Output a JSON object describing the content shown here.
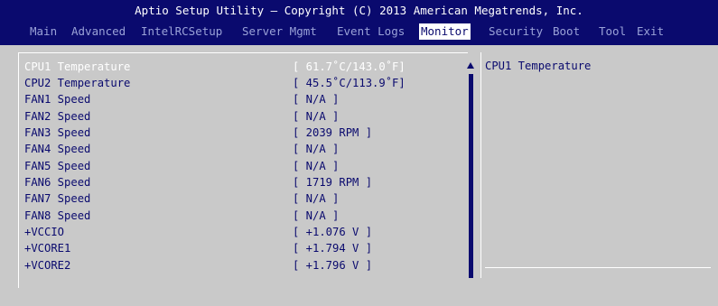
{
  "header": {
    "title": "Aptio Setup Utility – Copyright (C) 2013 American Megatrends, Inc."
  },
  "menu": {
    "tabs": [
      {
        "label": "Main",
        "active": false
      },
      {
        "label": "Advanced",
        "active": false
      },
      {
        "label": "IntelRCSetup",
        "active": false
      },
      {
        "label": "Server Mgmt",
        "active": false
      },
      {
        "label": "Event Logs",
        "active": false
      },
      {
        "label": "Monitor",
        "active": true
      },
      {
        "label": "Security",
        "active": false
      },
      {
        "label": "Boot",
        "active": false
      },
      {
        "label": "Tool",
        "active": false
      },
      {
        "label": "Exit",
        "active": false
      }
    ]
  },
  "monitor": {
    "rows": [
      {
        "label": "CPU1 Temperature",
        "value": "[ 61.7˚C/143.0˚F]",
        "selected": true
      },
      {
        "label": "CPU2 Temperature",
        "value": "[ 45.5˚C/113.9˚F]",
        "selected": false
      },
      {
        "label": "FAN1 Speed",
        "value": "[ N/A ]",
        "selected": false
      },
      {
        "label": "FAN2 Speed",
        "value": "[ N/A ]",
        "selected": false
      },
      {
        "label": "FAN3 Speed",
        "value": "[ 2039 RPM ]",
        "selected": false
      },
      {
        "label": "FAN4 Speed",
        "value": "[ N/A ]",
        "selected": false
      },
      {
        "label": "FAN5 Speed",
        "value": "[ N/A ]",
        "selected": false
      },
      {
        "label": "FAN6 Speed",
        "value": "[ 1719 RPM ]",
        "selected": false
      },
      {
        "label": "FAN7 Speed",
        "value": "[ N/A ]",
        "selected": false
      },
      {
        "label": "FAN8 Speed",
        "value": "[ N/A ]",
        "selected": false
      },
      {
        "label": "+VCCIO",
        "value": "[ +1.076 V ]",
        "selected": false
      },
      {
        "label": "+VCORE1",
        "value": "[ +1.794 V ]",
        "selected": false
      },
      {
        "label": "+VCORE2",
        "value": "[ +1.796 V ]",
        "selected": false
      }
    ]
  },
  "help": {
    "text": "CPU1 Temperature"
  },
  "colors": {
    "header_bg": "#0a0a6e",
    "body_bg": "#c9c9c9",
    "item_text": "#0a0a6e",
    "selected_text": "#ffffff",
    "tab_inactive": "#9aa2d8"
  }
}
